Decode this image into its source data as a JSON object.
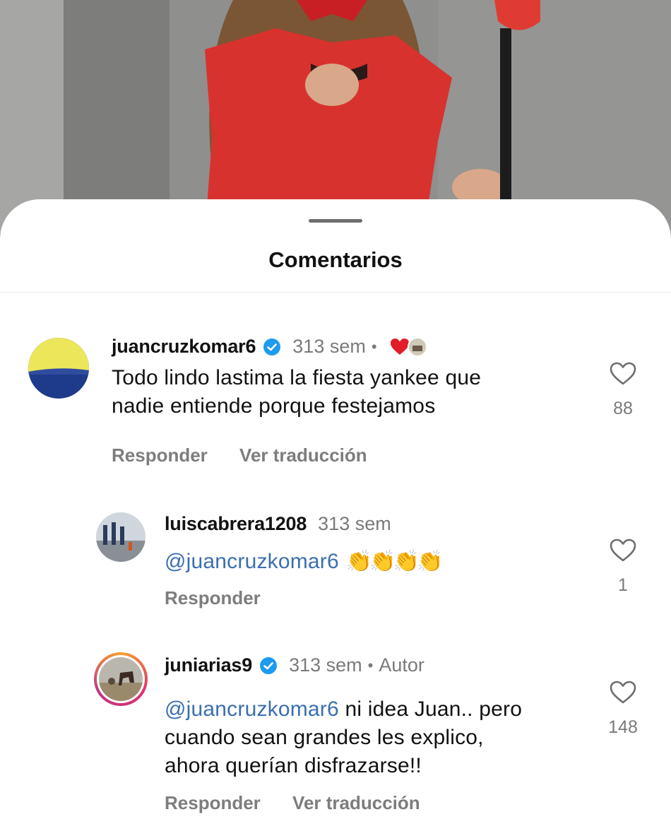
{
  "sheet": {
    "title": "Comentarios"
  },
  "comments": [
    {
      "username": "juancruzkomar6",
      "verified": true,
      "time": "313 sem",
      "text": "Todo lindo lastima la fiesta yankee que nadie entiende porque festejamos",
      "text_lines": [
        "Todo lindo lastima la fiesta yankee que",
        "nadie entiende porque festejamos"
      ],
      "reply_label": "Responder",
      "translate_label": "Ver traducción",
      "likes": "88",
      "liked_by_author": true
    },
    {
      "username": "luiscabrera1208",
      "verified": false,
      "time": "313 sem",
      "mention": "@juancruzkomar6",
      "emoji": "👏👏👏👏",
      "reply_label": "Responder",
      "likes": "1"
    },
    {
      "username": "juniarias9",
      "verified": true,
      "time": "313 sem",
      "author_label": "Autor",
      "mention": "@juancruzkomar6",
      "text_lines": [
        "ni idea Juan.. pero",
        "cuando sean grandes les explico,",
        "ahora querían disfrazarse!!"
      ],
      "reply_label": "Responder",
      "translate_label": "Ver traducción",
      "likes": "148"
    }
  ],
  "colors": {
    "verified": "#1d9bf0",
    "heart_reaction": "#e11d2a",
    "mention": "#3a6fb0",
    "muted": "#7a7a7a"
  },
  "icons": [
    "verified-badge-icon",
    "heart-outline-icon",
    "heart-filled-icon",
    "clap-emoji"
  ]
}
